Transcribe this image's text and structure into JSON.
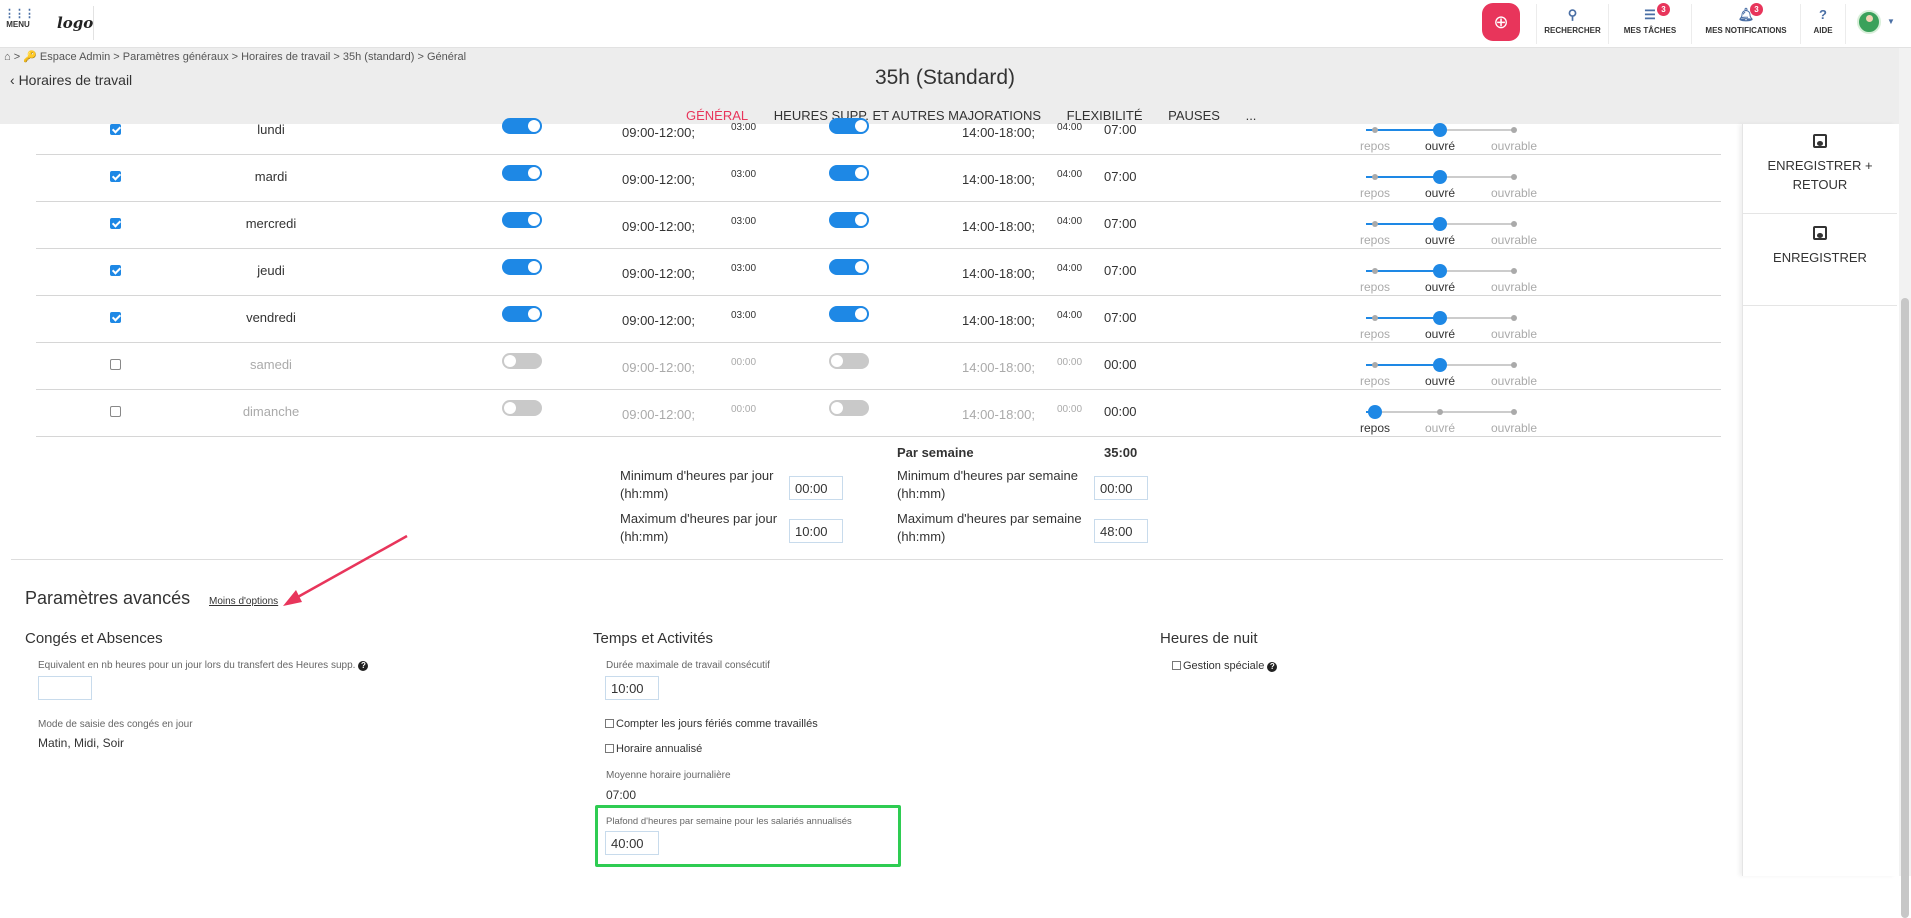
{
  "topbar": {
    "menu_label": "MENU",
    "logo_text": "logo",
    "items": [
      {
        "label": "RECHERCHER",
        "icon": "search-icon"
      },
      {
        "label": "MES TÂCHES",
        "icon": "tasks-icon",
        "badge": "3"
      },
      {
        "label": "MES NOTIFICATIONS",
        "icon": "bell-icon",
        "badge": "3"
      },
      {
        "label": "AIDE",
        "icon": "help-icon"
      }
    ]
  },
  "breadcrumb": "⌂ > 🔑 Espace Admin > Paramètres généraux > Horaires de travail > 35h (standard) > Général",
  "back_link": "Horaires de travail",
  "page_title": "35h (Standard)",
  "tabs": [
    "GÉNÉRAL",
    "HEURES SUPP. ET AUTRES MAJORATIONS",
    "FLEXIBILITÉ",
    "PAUSES",
    "..."
  ],
  "slider_labels": [
    "repos",
    "ouvré",
    "ouvrable"
  ],
  "days": [
    {
      "name": "lundi",
      "checked": true,
      "am_on": true,
      "am": "09:00-12:00;",
      "am_dur": "03:00",
      "pm_on": true,
      "pm": "14:00-18:00;",
      "pm_dur": "04:00",
      "total": "07:00",
      "level": "ouvré"
    },
    {
      "name": "mardi",
      "checked": true,
      "am_on": true,
      "am": "09:00-12:00;",
      "am_dur": "03:00",
      "pm_on": true,
      "pm": "14:00-18:00;",
      "pm_dur": "04:00",
      "total": "07:00",
      "level": "ouvré"
    },
    {
      "name": "mercredi",
      "checked": true,
      "am_on": true,
      "am": "09:00-12:00;",
      "am_dur": "03:00",
      "pm_on": true,
      "pm": "14:00-18:00;",
      "pm_dur": "04:00",
      "total": "07:00",
      "level": "ouvré"
    },
    {
      "name": "jeudi",
      "checked": true,
      "am_on": true,
      "am": "09:00-12:00;",
      "am_dur": "03:00",
      "pm_on": true,
      "pm": "14:00-18:00;",
      "pm_dur": "04:00",
      "total": "07:00",
      "level": "ouvré"
    },
    {
      "name": "vendredi",
      "checked": true,
      "am_on": true,
      "am": "09:00-12:00;",
      "am_dur": "03:00",
      "pm_on": true,
      "pm": "14:00-18:00;",
      "pm_dur": "04:00",
      "total": "07:00",
      "level": "ouvré"
    },
    {
      "name": "samedi",
      "checked": false,
      "am_on": false,
      "am": "09:00-12:00;",
      "am_dur": "00:00",
      "pm_on": false,
      "pm": "14:00-18:00;",
      "pm_dur": "00:00",
      "total": "00:00",
      "level": "ouvré"
    },
    {
      "name": "dimanche",
      "checked": false,
      "am_on": false,
      "am": "09:00-12:00;",
      "am_dur": "00:00",
      "pm_on": false,
      "pm": "14:00-18:00;",
      "pm_dur": "00:00",
      "total": "00:00",
      "level": "repos"
    }
  ],
  "summary": {
    "per_week_label": "Par semaine",
    "per_week_value": "35:00",
    "min_day_label": "Minimum d'heures par jour (hh:mm)",
    "min_day_value": "00:00",
    "max_day_label": "Maximum d'heures par jour (hh:mm)",
    "max_day_value": "10:00",
    "min_week_label": "Minimum d'heures par semaine (hh:mm)",
    "min_week_value": "00:00",
    "max_week_label": "Maximum d'heures par semaine (hh:mm)",
    "max_week_value": "48:00"
  },
  "right_panel": {
    "save_return": "ENREGISTRER + RETOUR",
    "save": "ENREGISTRER"
  },
  "advanced": {
    "title": "Paramètres avancés",
    "less_options": "Moins d'options",
    "conges": {
      "title": "Congés et Absences",
      "equiv_label": "Equivalent en nb heures pour un jour lors du transfert des Heures supp.",
      "equiv_value": "",
      "mode_label": "Mode de saisie des congés en jour",
      "mode_value": "Matin, Midi, Soir"
    },
    "temps": {
      "title": "Temps et Activités",
      "duree_label": "Durée maximale de travail consécutif",
      "duree_value": "10:00",
      "feries_label": "Compter les jours fériés comme travaillés",
      "annualise_label": "Horaire annualisé",
      "moyenne_label": "Moyenne horaire journalière",
      "moyenne_value": "07:00",
      "plafond_label": "Plafond d'heures par semaine pour les salariés annualisés",
      "plafond_value": "40:00"
    },
    "nuit": {
      "title": "Heures de nuit",
      "gestion_label": "Gestion spéciale"
    }
  },
  "colors": {
    "accent": "#e8355b",
    "blue": "#1e88e5",
    "highlight": "#2ecc52"
  }
}
